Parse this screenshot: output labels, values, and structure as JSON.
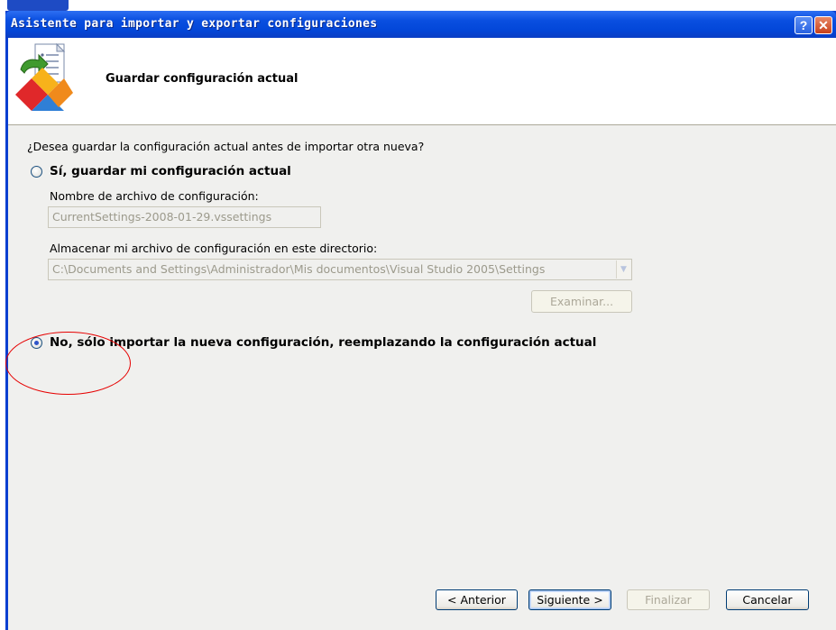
{
  "window": {
    "title": "Asistente para importar y exportar configuraciones",
    "help_icon": "question-mark-icon",
    "close_icon": "close-x-icon"
  },
  "header": {
    "title": "Guardar configuración actual",
    "icon": "settings-wizard-icon"
  },
  "question": "¿Desea guardar la configuración actual antes de importar otra nueva?",
  "option_save": {
    "label": "Sí, guardar mi configuración actual",
    "selected": false,
    "filename_label": "Nombre de archivo de configuración:",
    "filename_value": "CurrentSettings-2008-01-29.vssettings",
    "directory_label": "Almacenar mi archivo de configuración en este directorio:",
    "directory_value": "C:\\Documents and Settings\\Administrador\\Mis documentos\\Visual Studio 2005\\Settings",
    "browse_label": "Examinar..."
  },
  "option_no": {
    "label": "No, sólo importar la nueva configuración, reemplazando la configuración actual",
    "selected": true
  },
  "buttons": {
    "back": "< Anterior",
    "next": "Siguiente >",
    "finish": "Finalizar",
    "cancel": "Cancelar"
  },
  "colors": {
    "titlebar": "#0a4fe0",
    "annotation": "#e60000"
  }
}
